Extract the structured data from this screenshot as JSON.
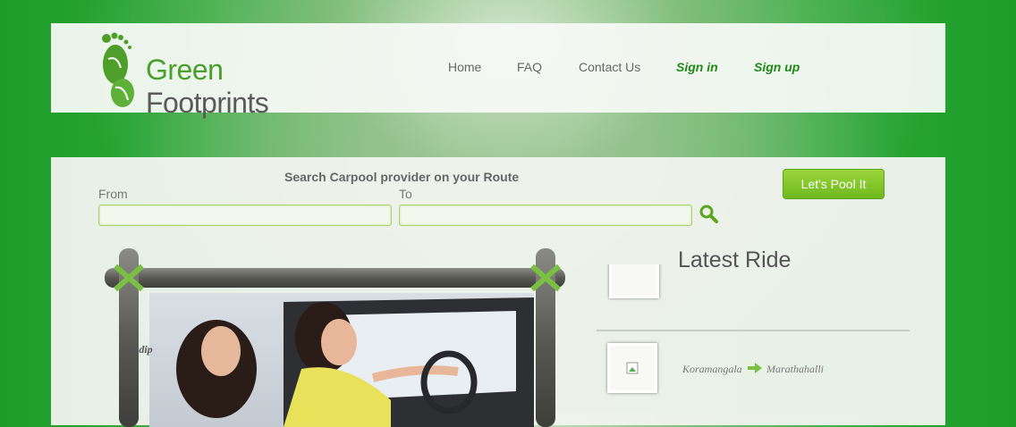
{
  "brand": {
    "name_green": "Green",
    "name_gray": "Footprints"
  },
  "nav": {
    "home": "Home",
    "faq": "FAQ",
    "contact": "Contact Us",
    "signin": "Sign in",
    "signup": "Sign up"
  },
  "search": {
    "title": "Search Carpool provider on your Route",
    "from_label": "From",
    "to_label": "To",
    "from_value": "",
    "to_value": ""
  },
  "pool_button": "Let's Pool It",
  "latest": {
    "heading": "Latest Ride",
    "rides": [
      {
        "name": "sandip",
        "from": "Koramangala",
        "to": "Marathahalli"
      }
    ]
  },
  "colors": {
    "accent_green": "#1f8a16",
    "button_green": "#7cc227",
    "input_border": "#a7d36a"
  }
}
